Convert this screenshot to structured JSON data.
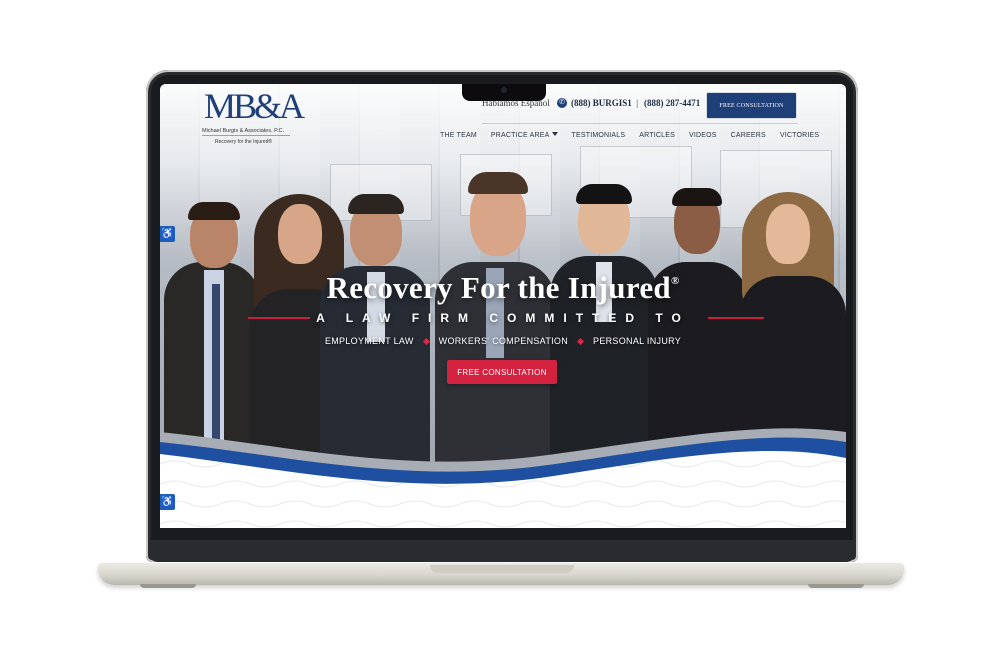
{
  "header": {
    "logo_mark": "MB&A",
    "firm_name": "Michael Burgis & Associates, P.C.",
    "tagline": "Recovery for the Injured®",
    "spanish_link": "Hablamos Español",
    "phone_primary": "(888) BURGIS1",
    "phone_separator": "|",
    "phone_secondary": "(888) 287-4471",
    "cta_label": "FREE CONSULTATION"
  },
  "nav": {
    "items": [
      {
        "label": "THE TEAM"
      },
      {
        "label": "PRACTICE AREA",
        "has_dropdown": true
      },
      {
        "label": "TESTIMONIALS"
      },
      {
        "label": "ARTICLES"
      },
      {
        "label": "VIDEOS"
      },
      {
        "label": "CAREERS"
      },
      {
        "label": "VICTORIES"
      }
    ]
  },
  "hero": {
    "title": "Recovery For the Injured",
    "title_mark": "®",
    "subtitle": "A LAW FIRM COMMITTED TO",
    "services": [
      "EMPLOYMENT LAW",
      "WORKERS' COMPENSATION",
      "PERSONAL INJURY"
    ],
    "cta_label": "FREE CONSULTATION"
  },
  "accessibility": {
    "icon": "wheelchair-icon",
    "glyph": "♿"
  },
  "colors": {
    "brand_navy": "#1f3f79",
    "accent_red": "#d3223f",
    "wave_blue": "#1e4fa0",
    "wave_silver": "#a8adb5"
  }
}
